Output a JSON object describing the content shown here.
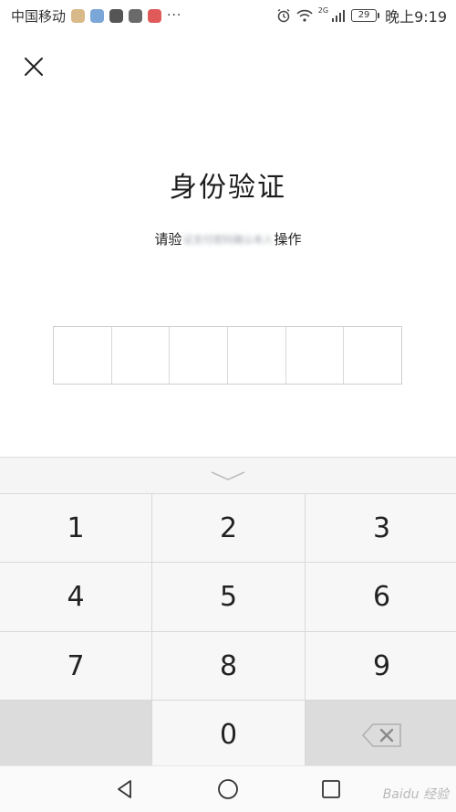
{
  "status_bar": {
    "carrier": "中国移动",
    "more": "···",
    "network": "2G",
    "battery": "29",
    "time": "晚上9:19",
    "app_icon_colors": [
      "#d9b98a",
      "#7aa6d8",
      "#555555",
      "#6a6a6a",
      "#e05a5a"
    ]
  },
  "page": {
    "title": "身份验证",
    "subtitle_prefix": "请验",
    "subtitle_blurred": "证支付密码确认本人",
    "subtitle_suffix": "操作"
  },
  "pin": {
    "length": 6
  },
  "keypad": {
    "keys": [
      "1",
      "2",
      "3",
      "4",
      "5",
      "6",
      "7",
      "8",
      "9",
      "0"
    ],
    "delete_icon": "backspace-icon"
  },
  "navbar": {
    "back_icon": "triangle-back-icon",
    "home_icon": "circle-home-icon",
    "recents_icon": "square-recents-icon"
  },
  "watermark": "Baidu 经验",
  "colors": {
    "accent": "#222222",
    "key_bg": "#f7f7f7",
    "key_dark_bg": "#dcdcdc"
  }
}
